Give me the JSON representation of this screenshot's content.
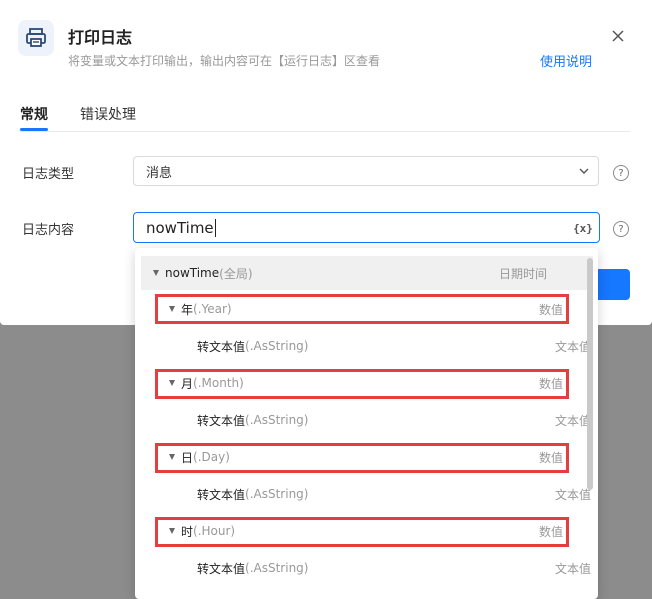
{
  "dialog": {
    "title": "打印日志",
    "subtitle": "将变量或文本打印输出，输出内容可在【运行日志】区查看",
    "help_link": "使用说明",
    "icons": {
      "title_icon": "printer-icon",
      "close": "close-icon"
    },
    "accent": "#1677ff"
  },
  "tabs": [
    {
      "label": "常规",
      "active": true
    },
    {
      "label": "错误处理",
      "active": false
    }
  ],
  "form": {
    "log_type": {
      "label": "日志类型",
      "value": "消息"
    },
    "log_content": {
      "label": "日志内容",
      "value": "nowTime",
      "var_icon": "{x}"
    },
    "help_glyph": "?"
  },
  "dropdown": {
    "rows": [
      {
        "name": "nowTime",
        "prop": "(全局)",
        "type": "日期时间",
        "expandable": true
      },
      {
        "name": "年",
        "prop": "(.Year)",
        "type": "数值",
        "expandable": true
      },
      {
        "name": "转文本值",
        "prop": "(.AsString)",
        "type": "文本值",
        "expandable": false
      },
      {
        "name": "月",
        "prop": "(.Month)",
        "type": "数值",
        "expandable": true
      },
      {
        "name": "转文本值",
        "prop": "(.AsString)",
        "type": "文本值",
        "expandable": false
      },
      {
        "name": "日",
        "prop": "(.Day)",
        "type": "数值",
        "expandable": true
      },
      {
        "name": "转文本值",
        "prop": "(.AsString)",
        "type": "文本值",
        "expandable": false
      },
      {
        "name": "时",
        "prop": "(.Hour)",
        "type": "数值",
        "expandable": true
      },
      {
        "name": "转文本值",
        "prop": "(.AsString)",
        "type": "文本值",
        "expandable": false
      }
    ],
    "highlight_color": "#e53e3e"
  }
}
